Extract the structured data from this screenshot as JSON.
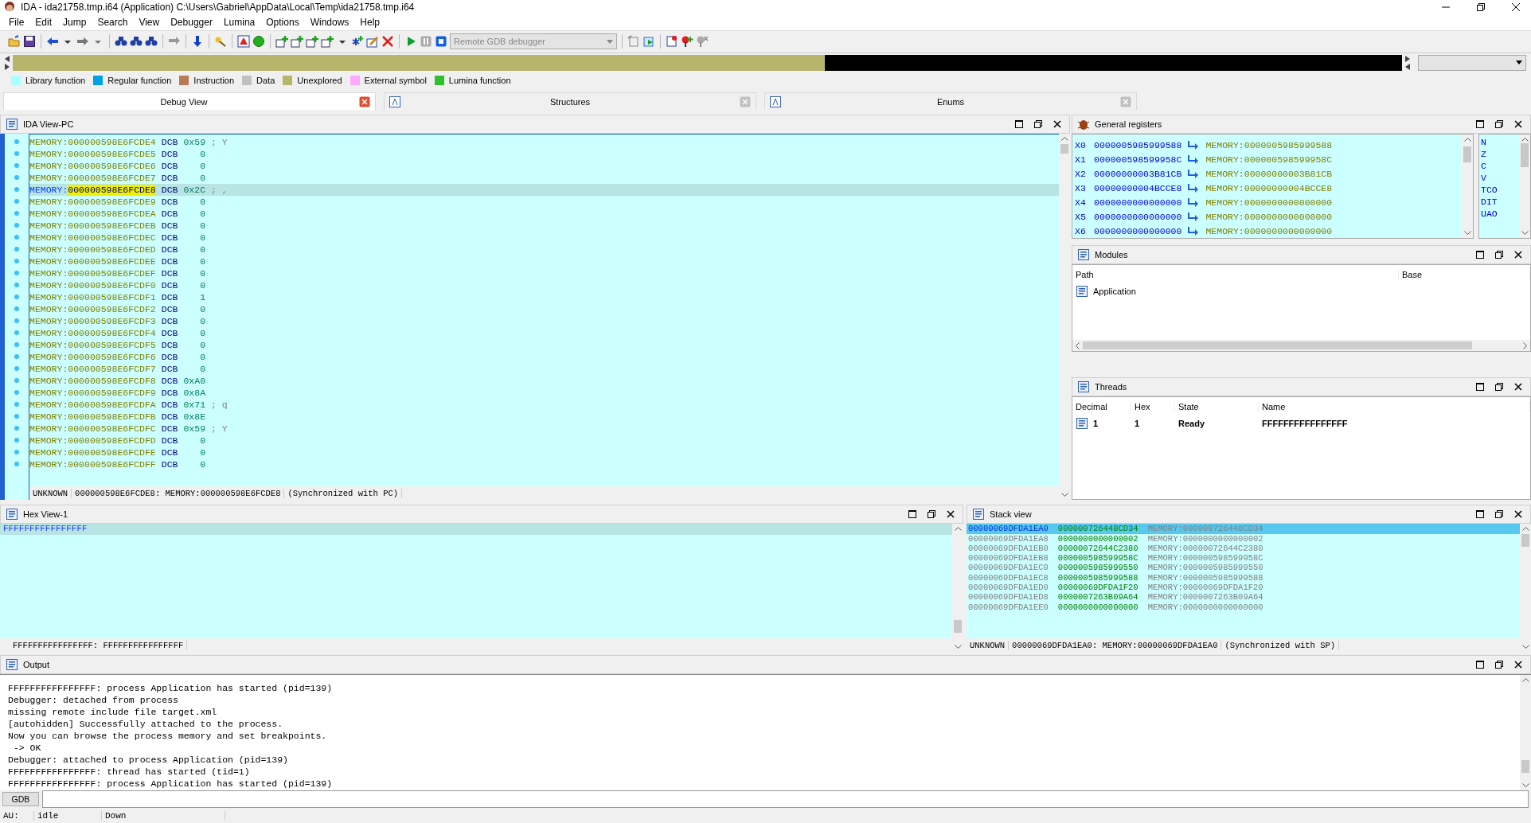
{
  "window": {
    "title": "IDA - ida21758.tmp.i64 (Application) C:\\Users\\Gabriel\\AppData\\Local\\Temp\\ida21758.tmp.i64"
  },
  "menu": [
    "File",
    "Edit",
    "Jump",
    "Search",
    "View",
    "Debugger",
    "Lumina",
    "Options",
    "Windows",
    "Help"
  ],
  "toolbar": {
    "debugger": "Remote GDB debugger"
  },
  "legend": [
    {
      "label": "Library function",
      "color": "#aaffff"
    },
    {
      "label": "Regular function",
      "color": "#00a0e8"
    },
    {
      "label": "Instruction",
      "color": "#b97a57"
    },
    {
      "label": "Data",
      "color": "#c0c0c0"
    },
    {
      "label": "Unexplored",
      "color": "#b5b56b"
    },
    {
      "label": "External symbol",
      "color": "#ffaaff"
    },
    {
      "label": "Lumina function",
      "color": "#30c030"
    }
  ],
  "tabs": [
    {
      "label": "Debug View",
      "selected": true
    },
    {
      "label": "Structures",
      "selected": false
    },
    {
      "label": "Enums",
      "selected": false
    }
  ],
  "ida_view": {
    "title": "IDA View-PC",
    "lines": [
      {
        "address": "MEMORY:000000598E6FCDE4",
        "mnemonic": "DCB",
        "operand": "0x59",
        "comment": "; Y",
        "current": false
      },
      {
        "address": "MEMORY:000000598E6FCDE5",
        "mnemonic": "DCB",
        "operand": "   0",
        "current": false
      },
      {
        "address": "MEMORY:000000598E6FCDE6",
        "mnemonic": "DCB",
        "operand": "   0",
        "current": false
      },
      {
        "address": "MEMORY:000000598E6FCDE7",
        "mnemonic": "DCB",
        "operand": "   0",
        "current": false
      },
      {
        "address": "MEMORY:000000598E6FCDE8",
        "mnemonic": "DCB",
        "operand": "0x2C",
        "comment": "; ,",
        "current": true
      },
      {
        "address": "MEMORY:000000598E6FCDE9",
        "mnemonic": "DCB",
        "operand": "   0",
        "current": false
      },
      {
        "address": "MEMORY:000000598E6FCDEA",
        "mnemonic": "DCB",
        "operand": "   0",
        "current": false
      },
      {
        "address": "MEMORY:000000598E6FCDEB",
        "mnemonic": "DCB",
        "operand": "   0",
        "current": false
      },
      {
        "address": "MEMORY:000000598E6FCDEC",
        "mnemonic": "DCB",
        "operand": "   0",
        "current": false
      },
      {
        "address": "MEMORY:000000598E6FCDED",
        "mnemonic": "DCB",
        "operand": "   0",
        "current": false
      },
      {
        "address": "MEMORY:000000598E6FCDEE",
        "mnemonic": "DCB",
        "operand": "   0",
        "current": false
      },
      {
        "address": "MEMORY:000000598E6FCDEF",
        "mnemonic": "DCB",
        "operand": "   0",
        "current": false
      },
      {
        "address": "MEMORY:000000598E6FCDF0",
        "mnemonic": "DCB",
        "operand": "   0",
        "current": false
      },
      {
        "address": "MEMORY:000000598E6FCDF1",
        "mnemonic": "DCB",
        "operand": "   1",
        "current": false
      },
      {
        "address": "MEMORY:000000598E6FCDF2",
        "mnemonic": "DCB",
        "operand": "   0",
        "current": false
      },
      {
        "address": "MEMORY:000000598E6FCDF3",
        "mnemonic": "DCB",
        "operand": "   0",
        "current": false
      },
      {
        "address": "MEMORY:000000598E6FCDF4",
        "mnemonic": "DCB",
        "operand": "   0",
        "current": false
      },
      {
        "address": "MEMORY:000000598E6FCDF5",
        "mnemonic": "DCB",
        "operand": "   0",
        "current": false
      },
      {
        "address": "MEMORY:000000598E6FCDF6",
        "mnemonic": "DCB",
        "operand": "   0",
        "current": false
      },
      {
        "address": "MEMORY:000000598E6FCDF7",
        "mnemonic": "DCB",
        "operand": "   0",
        "current": false
      },
      {
        "address": "MEMORY:000000598E6FCDF8",
        "mnemonic": "DCB",
        "operand": "0xA0",
        "current": false
      },
      {
        "address": "MEMORY:000000598E6FCDF9",
        "mnemonic": "DCB",
        "operand": "0x8A",
        "current": false
      },
      {
        "address": "MEMORY:000000598E6FCDFA",
        "mnemonic": "DCB",
        "operand": "0x71",
        "comment": "; q",
        "current": false
      },
      {
        "address": "MEMORY:000000598E6FCDFB",
        "mnemonic": "DCB",
        "operand": "0x8E",
        "current": false
      },
      {
        "address": "MEMORY:000000598E6FCDFC",
        "mnemonic": "DCB",
        "operand": "0x59",
        "comment": "; Y",
        "current": false
      },
      {
        "address": "MEMORY:000000598E6FCDFD",
        "mnemonic": "DCB",
        "operand": "   0",
        "current": false
      },
      {
        "address": "MEMORY:000000598E6FCDFE",
        "mnemonic": "DCB",
        "operand": "   0",
        "current": false
      },
      {
        "address": "MEMORY:000000598E6FCDFF",
        "mnemonic": "DCB",
        "operand": "   0",
        "current": false
      }
    ],
    "status": [
      "UNKNOWN",
      "000000598E6FCDE8: MEMORY:000000598E6FCDE8",
      "(Synchronized with PC)"
    ]
  },
  "registers": {
    "title": "General registers",
    "rows": [
      {
        "name": "X0",
        "value": "0000005985999588",
        "target": "MEMORY:0000005985999588"
      },
      {
        "name": "X1",
        "value": "000000598599958C",
        "target": "MEMORY:000000598599958C"
      },
      {
        "name": "X2",
        "value": "00000000003B81CB",
        "target": "MEMORY:00000000003B81CB"
      },
      {
        "name": "X3",
        "value": "00000000004BCCE8",
        "target": "MEMORY:00000000004BCCE8"
      },
      {
        "name": "X4",
        "value": "0000000000000000",
        "target": "MEMORY:0000000000000000"
      },
      {
        "name": "X5",
        "value": "0000000000000000",
        "target": "MEMORY:0000000000000000"
      },
      {
        "name": "X6",
        "value": "0000000000000000",
        "target": "MEMORY:0000000000000000"
      }
    ],
    "flags": [
      "N",
      "Z",
      "C",
      "V",
      "TCO",
      "DIT",
      "UAO"
    ]
  },
  "modules": {
    "title": "Modules",
    "columns": [
      "Path",
      "Base"
    ],
    "rows": [
      {
        "path": "Application"
      }
    ]
  },
  "threads": {
    "title": "Threads",
    "columns": [
      "Decimal",
      "Hex",
      "State",
      "Name"
    ],
    "rows": [
      {
        "decimal": "1",
        "hex": "1",
        "state": "Ready",
        "name": "FFFFFFFFFFFFFFFF"
      }
    ]
  },
  "hex_view": {
    "title": "Hex View-1",
    "lines": [
      "FFFFFFFFFFFFFFFF"
    ],
    "status": "FFFFFFFFFFFFFFFF: FFFFFFFFFFFFFFFF"
  },
  "stack_view": {
    "title": "Stack view",
    "rows": [
      {
        "address": "00000069DFDA1EA0",
        "value": "000000726448CD34",
        "target": "MEMORY:000000726448CD34",
        "selected": true
      },
      {
        "address": "00000069DFDA1EA8",
        "value": "0000000000000002",
        "target": "MEMORY:0000000000000002",
        "selected": false
      },
      {
        "address": "00000069DFDA1EB0",
        "value": "00000072644C2380",
        "target": "MEMORY:00000072644C2380",
        "selected": false
      },
      {
        "address": "00000069DFDA1EB8",
        "value": "000000598599958C",
        "target": "MEMORY:000000598599958C",
        "selected": false
      },
      {
        "address": "00000069DFDA1EC0",
        "value": "0000005985999550",
        "target": "MEMORY:0000005985999550",
        "selected": false
      },
      {
        "address": "00000069DFDA1EC8",
        "value": "0000005985999588",
        "target": "MEMORY:0000005985999588",
        "selected": false
      },
      {
        "address": "00000069DFDA1ED0",
        "value": "00000069DFDA1F20",
        "target": "MEMORY:00000069DFDA1F20",
        "selected": false
      },
      {
        "address": "00000069DFDA1ED8",
        "value": "0000007263B09A64",
        "target": "MEMORY:0000007263B09A64",
        "selected": false
      },
      {
        "address": "00000069DFDA1EE0",
        "value": "0000000000000000",
        "target": "MEMORY:0000000000000000",
        "selected": false
      }
    ],
    "status": [
      "UNKNOWN",
      "00000069DFDA1EA0: MEMORY:00000069DFDA1EA0",
      "(Synchronized with SP)"
    ]
  },
  "output": {
    "title": "Output",
    "lines": [
      "FFFFFFFFFFFFFFFF: process Application has started (pid=139)",
      "Debugger: detached from process",
      "missing remote include file target.xml",
      "[autohidden] Successfully attached to the process.",
      "Now you can browse the process memory and set breakpoints.",
      " -> OK",
      "Debugger: attached to process Application (pid=139)",
      "FFFFFFFFFFFFFFFF: thread has started (tid=1)",
      "FFFFFFFFFFFFFFFF: process Application has started (pid=139)"
    ]
  },
  "command": {
    "button": "GDB"
  },
  "status_bar": [
    "AU:",
    "idle",
    "Down"
  ]
}
